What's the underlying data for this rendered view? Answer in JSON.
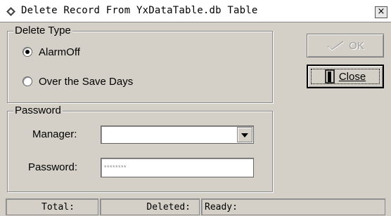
{
  "window": {
    "title": "Delete Record From YxDataTable.db Table",
    "title_icon": "app-diamond-icon",
    "close_glyph": "×"
  },
  "delete_type": {
    "legend": "Delete Type",
    "options": [
      {
        "label": "AlarmOff",
        "checked": true
      },
      {
        "label": "Over the Save Days",
        "checked": false
      }
    ]
  },
  "password_group": {
    "legend": "Password",
    "manager_label": "Manager:",
    "manager_value": "",
    "password_label": "Password:",
    "password_value": "********"
  },
  "buttons": {
    "ok_label": "OK",
    "ok_enabled": false,
    "ok_icon": "checkmark-icon",
    "close_label": "Close",
    "close_icon": "door-icon"
  },
  "status": {
    "total": "Total:",
    "deleted": "Deleted:",
    "ready": "Ready:"
  }
}
